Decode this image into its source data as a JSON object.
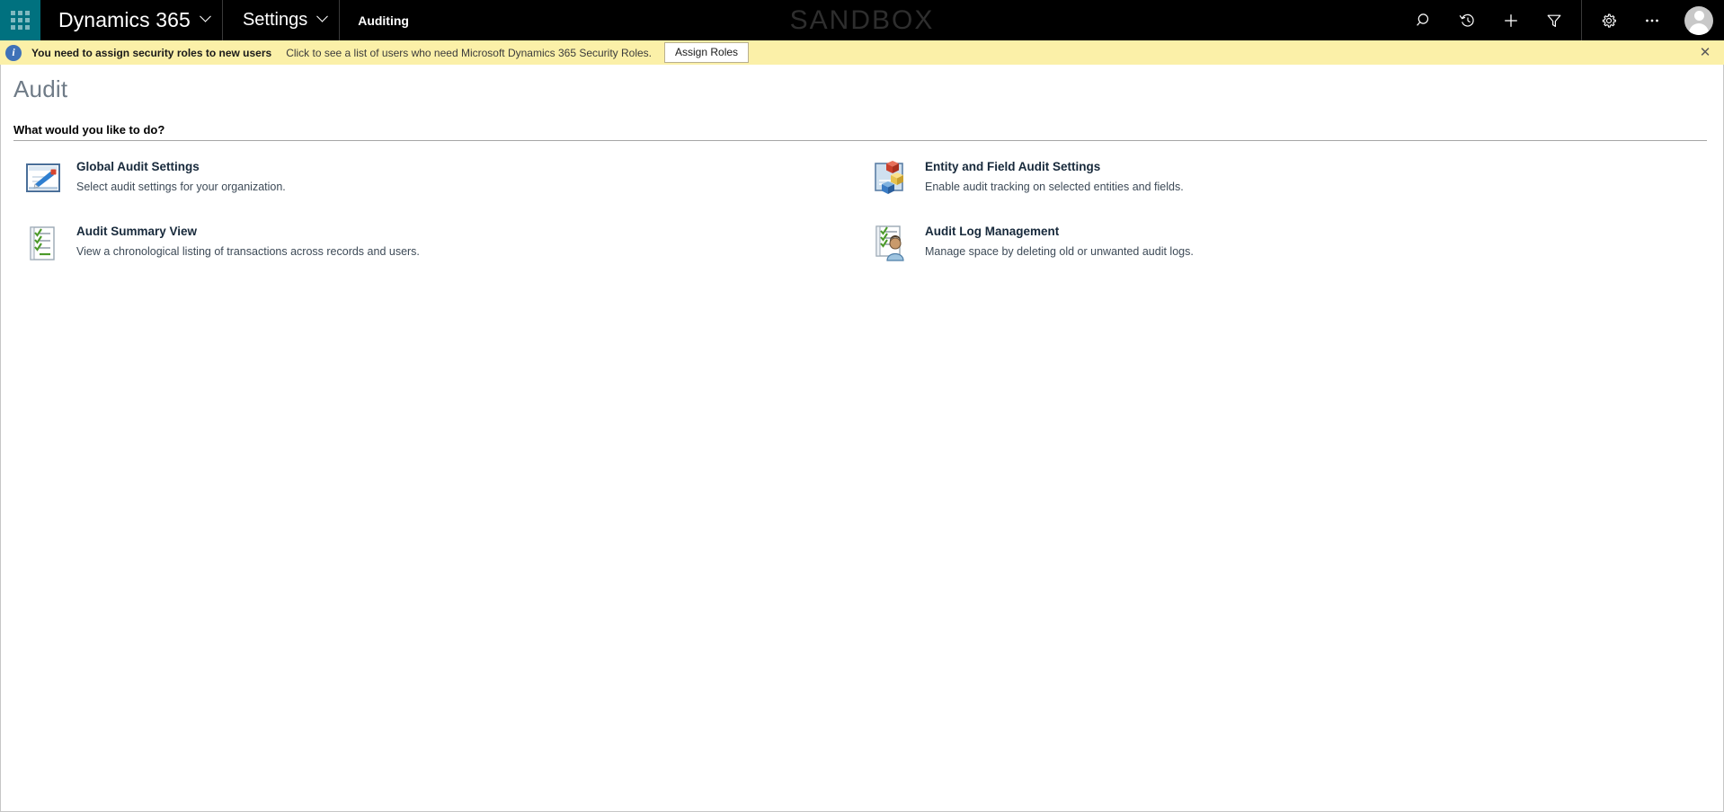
{
  "topbar": {
    "waffle_label": "app-launcher",
    "app_name": "Dynamics 365",
    "area_name": "Settings",
    "sub_area_name": "Auditing",
    "watermark": "SANDBOX",
    "icons": [
      {
        "name": "search-icon",
        "label": "Search"
      },
      {
        "name": "history-icon",
        "label": "Recently viewed"
      },
      {
        "name": "plus-icon",
        "label": "Quick create"
      },
      {
        "name": "filter-icon",
        "label": "Advanced find"
      },
      {
        "name": "gear-icon",
        "label": "Settings"
      },
      {
        "name": "ellipsis-icon",
        "label": "More"
      }
    ],
    "avatar_label": "User profile"
  },
  "notification": {
    "info_glyph": "i",
    "title": "You need to assign security roles to new users",
    "description": "Click to see a list of users who need Microsoft Dynamics 365 Security Roles.",
    "action_label": "Assign Roles",
    "close_glyph": "✕",
    "background_color": "#fbf0a8"
  },
  "page": {
    "title": "Audit",
    "section_heading": "What would you like to do?"
  },
  "tiles": [
    {
      "icon": "global-audit-settings-icon",
      "title": "Global Audit Settings",
      "description": "Select audit settings for your organization."
    },
    {
      "icon": "entity-field-audit-settings-icon",
      "title": "Entity and Field Audit Settings",
      "description": "Enable audit tracking on selected entities and fields."
    },
    {
      "icon": "audit-summary-view-icon",
      "title": "Audit Summary View",
      "description": "View a chronological listing of transactions across records and users."
    },
    {
      "icon": "audit-log-management-icon",
      "title": "Audit Log Management",
      "description": "Manage space by deleting old or unwanted audit logs."
    }
  ],
  "theme": {
    "accent_teal": "#00717f",
    "topbar_black": "#000000",
    "notification_yellow": "#fbf0a8",
    "title_gray": "#6f7b87"
  }
}
